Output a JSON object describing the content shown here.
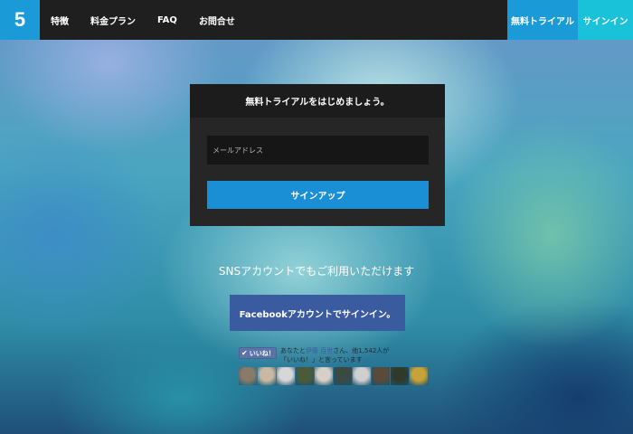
{
  "header": {
    "logo": "5",
    "nav": [
      "特徴",
      "料金プラン",
      "FAQ",
      "お問合せ"
    ],
    "trial_button": "無料トライアル",
    "signin_button": "サインイン"
  },
  "signup": {
    "title": "無料トライアルをはじめましょう。",
    "email_placeholder": "メールアドレス",
    "submit_label": "サインアップ"
  },
  "sns": {
    "text": "SNSアカウントでもご利用いただけます",
    "facebook_button": "Facebookアカウントでサインイン。"
  },
  "like_box": {
    "button_label": "いいね！",
    "text_before": "あなたと",
    "friend_name": "伊藤 百世",
    "text_after": "さん、他1,542人が「いいね！」と言っています"
  },
  "faces": [
    {
      "color": "#8a7a6a"
    },
    {
      "color": "#c9b9a3"
    },
    {
      "color": "#d7d7d7"
    },
    {
      "color": "#4b5a3a"
    },
    {
      "color": "#d7d0c8"
    },
    {
      "color": "#3a4a42"
    },
    {
      "color": "#cfcfcf"
    },
    {
      "color": "#5a4a3a"
    },
    {
      "color": "#2f3a2a"
    },
    {
      "color": "#c8a23a"
    }
  ],
  "colors": {
    "accent": "#1a9ad6",
    "signin": "#19c2d8",
    "facebook": "#3b5ba1"
  }
}
